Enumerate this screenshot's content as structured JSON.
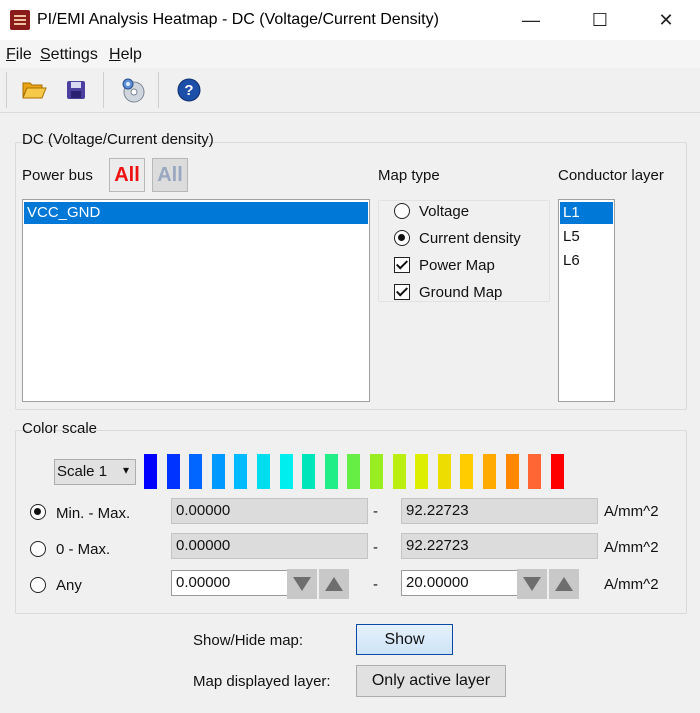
{
  "window": {
    "title": "PI/EMI Analysis Heatmap - DC (Voltage/Current Density)",
    "minimize_glyph": "—",
    "maximize_glyph": "☐",
    "close_glyph": "✕"
  },
  "menu": [
    {
      "accel": "F",
      "rest": "ile"
    },
    {
      "accel": "S",
      "rest": "ettings"
    },
    {
      "accel": "H",
      "rest": "elp"
    }
  ],
  "toolbar": {
    "icons": [
      "open-folder-icon",
      "save-icon",
      "settings-disc-icon",
      "help-icon"
    ],
    "help_glyph": "?"
  },
  "dc_group": {
    "title": "DC (Voltage/Current density)",
    "power_bus": {
      "label": "Power bus",
      "all_button_active": "All",
      "all_button_inactive": "All",
      "items": [
        {
          "label": "VCC_GND",
          "selected": true
        }
      ]
    },
    "map_type": {
      "label": "Map type",
      "radios": [
        {
          "label": "Voltage",
          "checked": false
        },
        {
          "label": "Current density",
          "checked": true
        }
      ],
      "checkboxes": [
        {
          "label": "Power Map",
          "checked": true
        },
        {
          "label": "Ground Map",
          "checked": true
        }
      ]
    },
    "conductor_layer": {
      "label": "Conductor layer",
      "items": [
        {
          "label": "L1",
          "selected": true
        },
        {
          "label": "L5",
          "selected": false
        },
        {
          "label": "L6",
          "selected": false
        }
      ]
    }
  },
  "color_scale": {
    "title": "Color scale",
    "scale_select": {
      "value": "Scale 1",
      "arrow": "▾"
    },
    "swatches": [
      "#0000ff",
      "#0033ff",
      "#0066ff",
      "#0099ff",
      "#00bbff",
      "#00ddee",
      "#00eeee",
      "#00e6bb",
      "#22ee88",
      "#66ee44",
      "#99ee22",
      "#bbee11",
      "#ddee00",
      "#eedd00",
      "#ffcc00",
      "#ffaa00",
      "#ff8800",
      "#ff6633",
      "#ff0000"
    ],
    "rows": [
      {
        "label": "Min. - Max.",
        "checked": true,
        "min": "0.00000",
        "dash": "-",
        "max": "92.22723",
        "unit": "A/mm^2",
        "editable": false
      },
      {
        "label": "0 - Max.",
        "checked": false,
        "min": "0.00000",
        "dash": "-",
        "max": "92.22723",
        "unit": "A/mm^2",
        "editable": false
      },
      {
        "label": "Any",
        "checked": false,
        "min": "0.00000",
        "dash": "-",
        "max": "20.00000",
        "unit": "A/mm^2",
        "editable": true
      }
    ]
  },
  "footer": {
    "show_hide_label": "Show/Hide map:",
    "show_button": "Show",
    "displayed_layer_label": "Map displayed layer:",
    "displayed_layer_button": "Only active layer"
  },
  "colors": {
    "selection": "#0078d7",
    "all_active": "#ee1111",
    "all_inactive": "#99a8c0"
  }
}
